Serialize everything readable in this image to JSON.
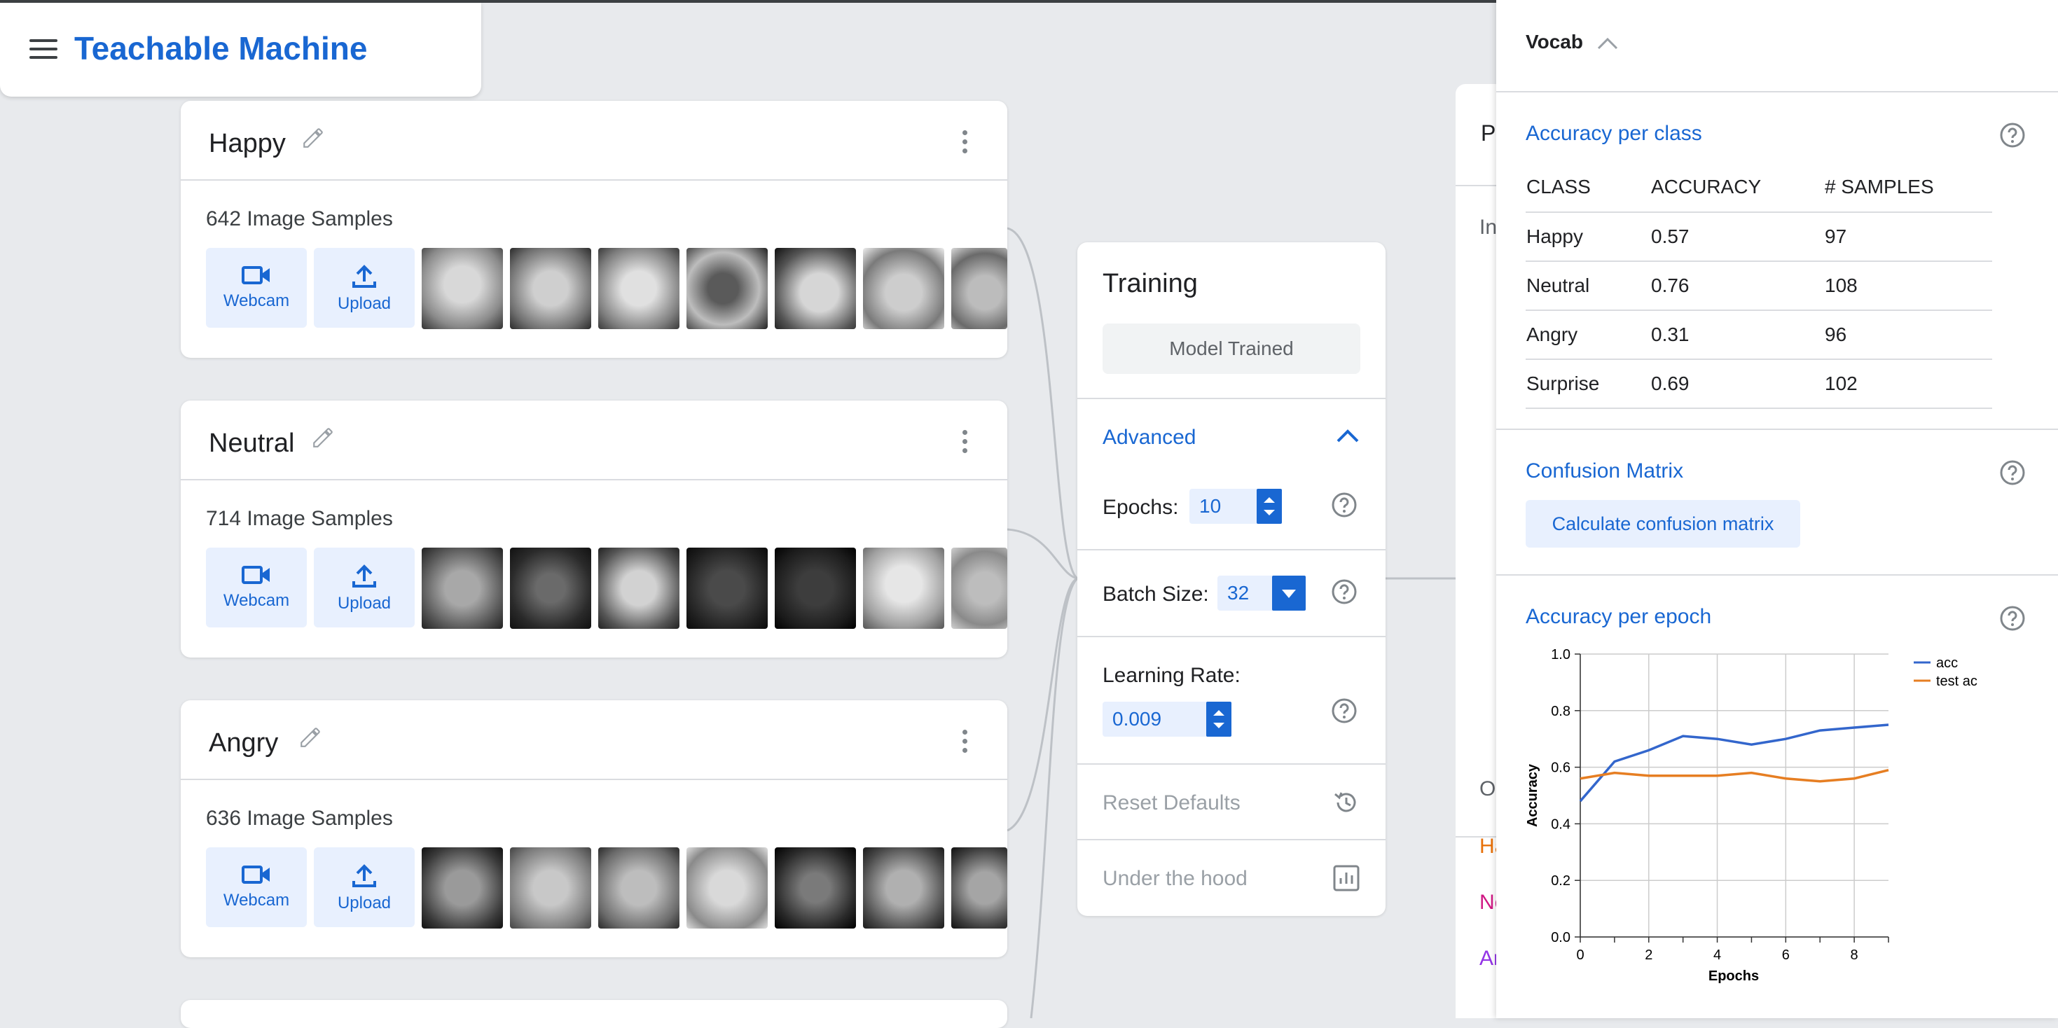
{
  "app": {
    "title": "Teachable Machine"
  },
  "classes": [
    {
      "name": "Happy",
      "samples": "642 Image Samples"
    },
    {
      "name": "Neutral",
      "samples": "714 Image Samples"
    },
    {
      "name": "Angry",
      "samples": "636 Image Samples"
    }
  ],
  "sample_buttons": {
    "webcam": "Webcam",
    "upload": "Upload"
  },
  "training": {
    "title": "Training",
    "trained_label": "Model Trained",
    "advanced_label": "Advanced",
    "epochs_label": "Epochs:",
    "epochs_value": "10",
    "batch_label": "Batch Size:",
    "batch_value": "32",
    "lr_label": "Learning Rate:",
    "lr_value": "0.009",
    "reset_label": "Reset Defaults",
    "hood_label": "Under the hood"
  },
  "preview_partial": {
    "p": "P",
    "in": "In",
    "o": "O",
    "ha": "Ha",
    "ne": "Ne",
    "an": "An"
  },
  "panel": {
    "vocab_label": "Vocab",
    "accuracy_title": "Accuracy per class",
    "table_headers": [
      "CLASS",
      "ACCURACY",
      "# SAMPLES"
    ],
    "table_rows": [
      [
        "Happy",
        "0.57",
        "97"
      ],
      [
        "Neutral",
        "0.76",
        "108"
      ],
      [
        "Angry",
        "0.31",
        "96"
      ],
      [
        "Surprise",
        "0.69",
        "102"
      ]
    ],
    "confusion_title": "Confusion Matrix",
    "confusion_button": "Calculate confusion matrix",
    "epoch_title": "Accuracy per epoch"
  },
  "colors": {
    "accent": "#1967d2",
    "acc_series": "#3366cc",
    "test_series": "#e67e22"
  },
  "chart_data": {
    "type": "line",
    "xlabel": "Epochs",
    "ylabel": "Accuracy",
    "xlim": [
      0,
      9
    ],
    "ylim": [
      0,
      1
    ],
    "x_ticks": [
      "0",
      "2",
      "4",
      "6",
      "8"
    ],
    "y_ticks": [
      "0.0",
      "0.2",
      "0.4",
      "0.6",
      "0.8",
      "1.0"
    ],
    "x": [
      0,
      1,
      2,
      3,
      4,
      5,
      6,
      7,
      8,
      9
    ],
    "series": [
      {
        "name": "acc",
        "values": [
          0.48,
          0.62,
          0.66,
          0.71,
          0.7,
          0.68,
          0.7,
          0.73,
          0.74,
          0.75
        ]
      },
      {
        "name": "test ac",
        "values": [
          0.56,
          0.58,
          0.57,
          0.57,
          0.57,
          0.58,
          0.56,
          0.55,
          0.56,
          0.59
        ]
      }
    ],
    "grid": true,
    "legend": "right"
  }
}
